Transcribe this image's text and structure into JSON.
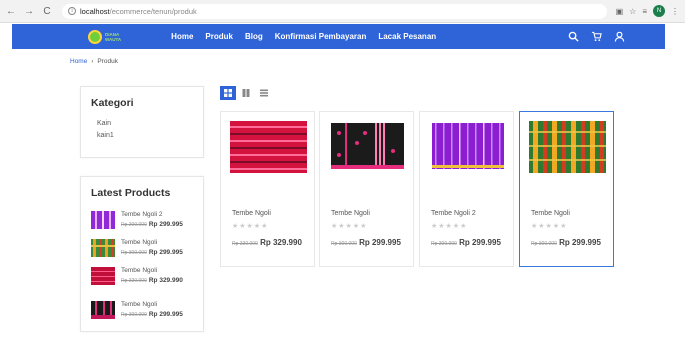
{
  "browser": {
    "url_host": "localhost",
    "url_path": "/ecommerce/tenun/produk",
    "profile_initial": "N"
  },
  "navbar": {
    "logo_text_line1": "DIANA",
    "logo_text_line2": "WAUTA",
    "links": [
      "Home",
      "Produk",
      "Blog",
      "Konfirmasi Pembayaran",
      "Lacak Pesanan"
    ],
    "color": "#2f63d8"
  },
  "breadcrumb": {
    "home": "Home",
    "separator": "›",
    "current": "Produk"
  },
  "sidebar": {
    "kategori_title": "Kategori",
    "kategori_items": [
      "Kain",
      "kain1"
    ],
    "latest_title": "Latest Products",
    "latest_products": [
      {
        "name": "Tembe Ngoli 2",
        "old_price": "Rp 300.000",
        "new_price": "Rp 299.995"
      },
      {
        "name": "Tembe Ngoli",
        "old_price": "Rp 300.000",
        "new_price": "Rp 299.995"
      },
      {
        "name": "Tembe Ngoli",
        "old_price": "Rp 330.000",
        "new_price": "Rp 329.990"
      },
      {
        "name": "Tembe Ngoli",
        "old_price": "Rp 300.000",
        "new_price": "Rp 299.995"
      }
    ]
  },
  "view_toggles": [
    "grid-view",
    "list-view",
    "compact-list-view"
  ],
  "products": [
    {
      "name": "Tembe Ngoli",
      "stars": "★★★★★",
      "old_price": "Rp 330.000",
      "new_price": "Rp 329.990"
    },
    {
      "name": "Tembe Ngoli",
      "stars": "★★★★★",
      "old_price": "Rp 300.000",
      "new_price": "Rp 299.995"
    },
    {
      "name": "Tembe Ngoli 2",
      "stars": "★★★★★",
      "old_price": "Rp 300.000",
      "new_price": "Rp 299.995"
    },
    {
      "name": "Tembe Ngoli",
      "stars": "★★★★★",
      "old_price": "Rp 300.000",
      "new_price": "Rp 299.995"
    }
  ]
}
